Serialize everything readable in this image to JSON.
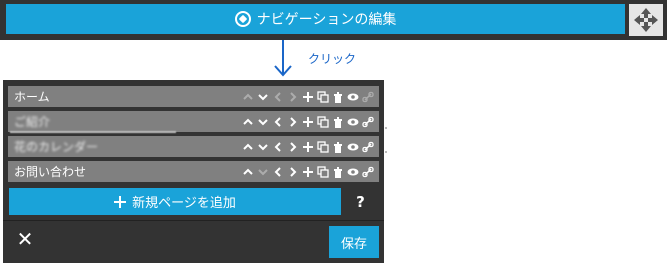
{
  "topbar": {
    "edit_nav_label": "ナビゲーションの編集",
    "edit_icon": "compass-icon",
    "move_icon": "move-arrows-icon"
  },
  "annotation": {
    "click_label": "クリック"
  },
  "menu": {
    "items": [
      {
        "label": "ホーム",
        "blurred": false
      },
      {
        "label": "ご紹介",
        "blurred": true
      },
      {
        "label": "花のカレンダー",
        "blurred": true
      },
      {
        "label": "お問い合わせ",
        "blurred": false
      }
    ],
    "row_icons": [
      "move-up-icon",
      "move-down-icon",
      "outdent-icon",
      "indent-icon",
      "add-subpage-icon",
      "duplicate-icon",
      "delete-icon",
      "visibility-icon",
      "link-icon"
    ]
  },
  "actions": {
    "add_page_label": "新規ページを追加",
    "help_label": "?",
    "close_label": "✕",
    "save_label": "保存"
  },
  "colors": {
    "accent": "#1aa3d9",
    "panel": "#333333",
    "row": "#808080",
    "annotation": "#1a66c8"
  }
}
